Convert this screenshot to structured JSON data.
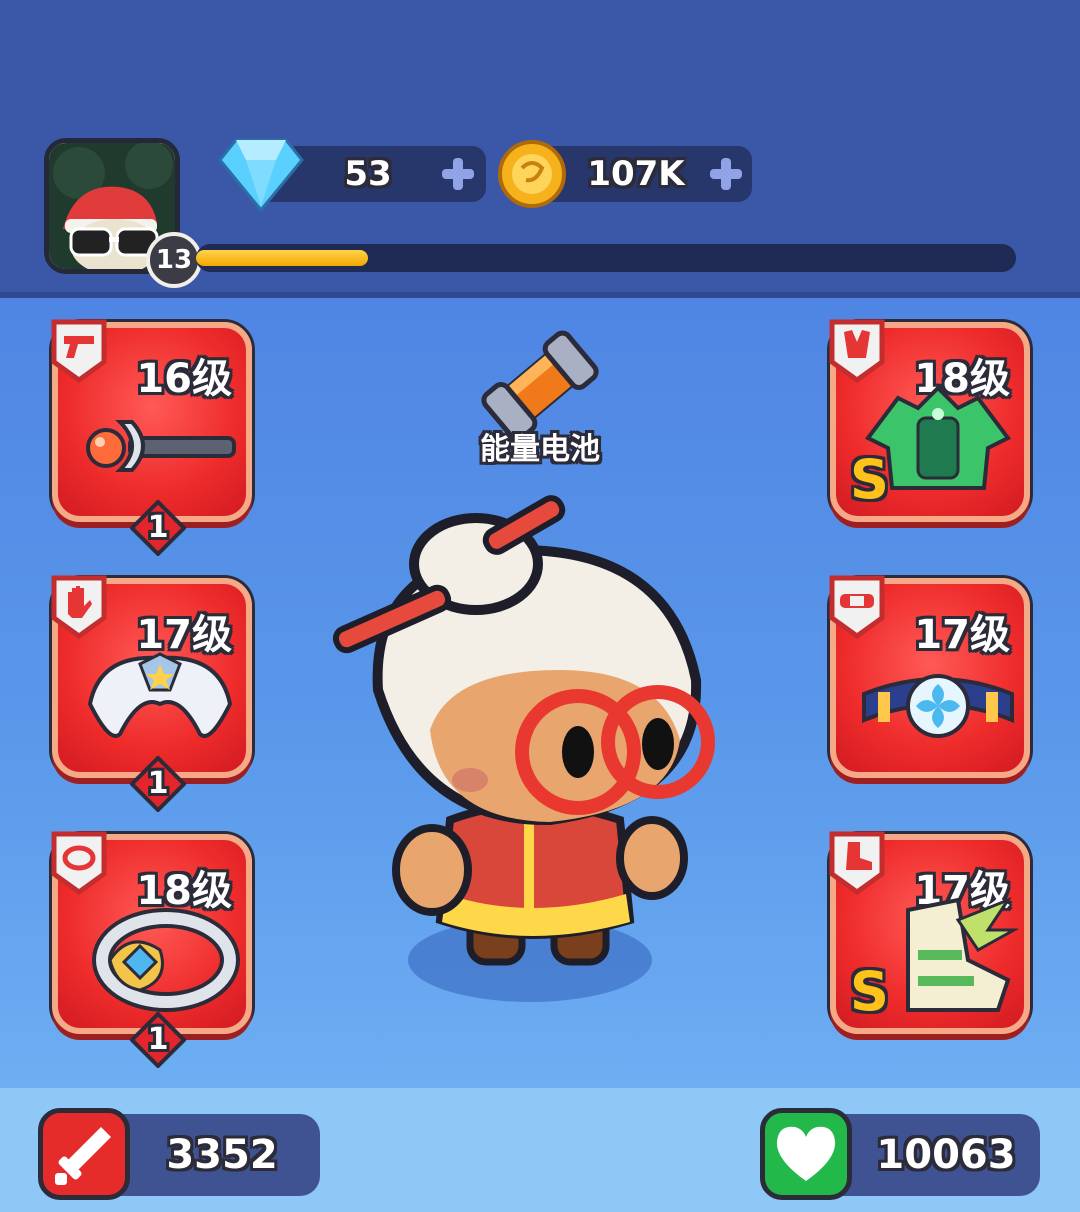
{
  "player": {
    "level": "13",
    "xp_progress": 0.21
  },
  "currency": {
    "gems": "53",
    "coins": "107K"
  },
  "colors": {
    "card_red": "#ee2b2b",
    "xp_yellow": "#f2a800",
    "attack_red": "#e62b2b",
    "health_green": "#22b84a"
  },
  "equipment": {
    "left": [
      {
        "slot": "weapon",
        "icon": "pistol-icon",
        "level": "16级",
        "count": "1"
      },
      {
        "slot": "gloves",
        "icon": "hand-icon",
        "level": "17级",
        "count": "1"
      },
      {
        "slot": "ring",
        "icon": "ring-icon",
        "level": "18级",
        "count": "1"
      }
    ],
    "right": [
      {
        "slot": "armor",
        "icon": "vest-icon",
        "level": "18级",
        "rank": "S"
      },
      {
        "slot": "belt",
        "icon": "belt-icon",
        "level": "17级"
      },
      {
        "slot": "boots",
        "icon": "boot-icon",
        "level": "17级",
        "rank": "S"
      }
    ]
  },
  "item_drop": {
    "label": "能量电池"
  },
  "stats": {
    "attack": "3352",
    "health": "10063"
  }
}
